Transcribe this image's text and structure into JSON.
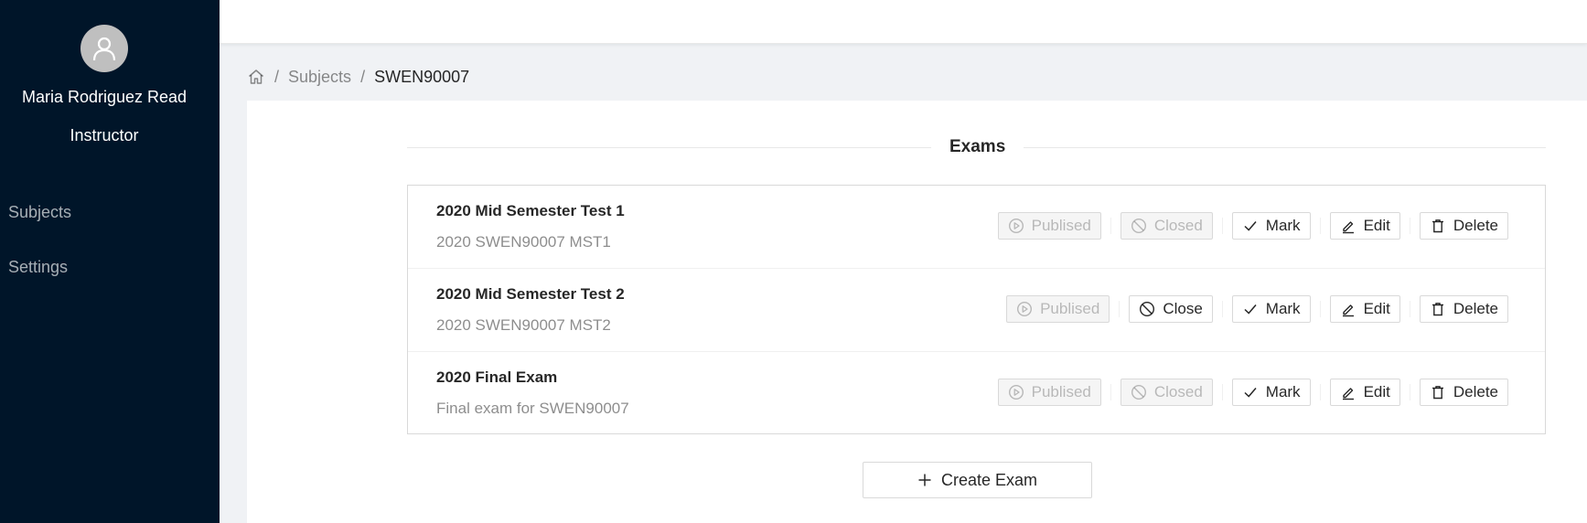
{
  "user": {
    "name": "Maria Rodriguez Read",
    "role": "Instructor"
  },
  "menu": {
    "subjects": "Subjects",
    "settings": "Settings"
  },
  "breadcrumb": {
    "subjects": "Subjects",
    "separator": "/",
    "current": "SWEN90007"
  },
  "section": {
    "title": "Exams"
  },
  "exams": [
    {
      "title": "2020 Mid Semester Test 1",
      "description": "2020 SWEN90007 MST1",
      "publish": "Publised",
      "close": "Closed",
      "mark": "Mark",
      "edit": "Edit",
      "delete": "Delete"
    },
    {
      "title": "2020 Mid Semester Test 2",
      "description": "2020 SWEN90007 MST2",
      "publish": "Publised",
      "close": "Close",
      "mark": "Mark",
      "edit": "Edit",
      "delete": "Delete"
    },
    {
      "title": "2020 Final Exam",
      "description": "Final exam for SWEN90007",
      "publish": "Publised",
      "close": "Closed",
      "mark": "Mark",
      "edit": "Edit",
      "delete": "Delete"
    }
  ],
  "create_button": "Create Exam",
  "icons": {
    "avatar": "user-icon",
    "home": "home-icon",
    "publish": "play-circle-icon",
    "close": "stop-icon",
    "mark": "check-icon",
    "edit": "edit-icon",
    "delete": "delete-icon",
    "create": "plus-icon"
  },
  "colors": {
    "sidebar": "#001529",
    "avatar": "#bfbfbf",
    "disabled_bg": "#f5f5f5",
    "border": "#d9d9d9"
  }
}
